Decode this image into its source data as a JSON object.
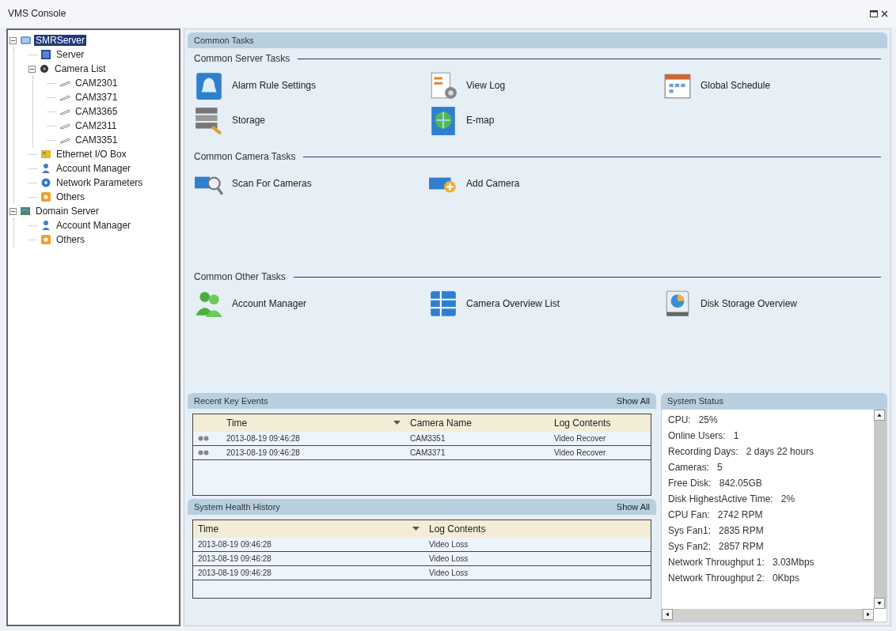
{
  "window": {
    "title": "VMS Console"
  },
  "tree": [
    {
      "label": "SMRServer",
      "kind": "server-group",
      "selected": true,
      "expanded": true,
      "children": [
        {
          "label": "Server",
          "kind": "monitor",
          "selected": false
        },
        {
          "label": "Camera List",
          "kind": "camera-group",
          "selected": false,
          "expanded": true,
          "children": [
            {
              "label": "CAM2301",
              "kind": "camera",
              "selected": false
            },
            {
              "label": "CAM3371",
              "kind": "camera",
              "selected": false
            },
            {
              "label": "CAM3365",
              "kind": "camera",
              "selected": false
            },
            {
              "label": "CAM2311",
              "kind": "camera",
              "selected": false
            },
            {
              "label": "CAM3351",
              "kind": "camera",
              "selected": false
            }
          ]
        },
        {
          "label": "Ethernet I/O Box",
          "kind": "io-box",
          "selected": false
        },
        {
          "label": "Account Manager",
          "kind": "user",
          "selected": false
        },
        {
          "label": "Network Parameters",
          "kind": "network",
          "selected": false
        },
        {
          "label": "Others",
          "kind": "others",
          "selected": false
        }
      ]
    },
    {
      "label": "Domain Server",
      "kind": "domain",
      "selected": false,
      "expanded": true,
      "children": [
        {
          "label": "Account Manager",
          "kind": "user",
          "selected": false
        },
        {
          "label": "Others",
          "kind": "others",
          "selected": false
        }
      ]
    }
  ],
  "common_tasks": {
    "title": "Common Tasks",
    "groups": [
      {
        "title": "Common Server Tasks",
        "items": [
          {
            "label": "Alarm Rule Settings",
            "kind": "alarm"
          },
          {
            "label": "View Log",
            "kind": "log"
          },
          {
            "label": "Global Schedule",
            "kind": "calendar"
          },
          {
            "label": "Storage",
            "kind": "storage"
          },
          {
            "label": "E-map",
            "kind": "globe"
          }
        ]
      },
      {
        "title": "Common Camera Tasks",
        "items": [
          {
            "label": "Scan For Cameras",
            "kind": "scan"
          },
          {
            "label": "Add Camera",
            "kind": "add-camera"
          }
        ]
      },
      {
        "title": "Common Other Tasks",
        "items": [
          {
            "label": "Account Manager",
            "kind": "users"
          },
          {
            "label": "Camera Overview List",
            "kind": "grid"
          },
          {
            "label": "Disk Storage Overview",
            "kind": "disk"
          }
        ]
      }
    ]
  },
  "recent_key_events": {
    "title": "Recent Key Events",
    "action": "Show All",
    "columns": [
      {
        "label": "Time",
        "sorted": true
      },
      {
        "label": "Camera Name",
        "sorted": false
      },
      {
        "label": "Log Contents",
        "sorted": false
      }
    ],
    "rows": [
      [
        "2013-08-19 09:46:28",
        "CAM3351",
        "Video Recover"
      ],
      [
        "2013-08-19 09:46:28",
        "CAM3371",
        "Video Recover"
      ]
    ]
  },
  "system_health_history": {
    "title": "System Health History",
    "action": "Show All",
    "columns": [
      {
        "label": "Time",
        "sorted": true
      },
      {
        "label": "Log Contents",
        "sorted": false
      }
    ],
    "rows": [
      [
        "2013-08-19 09:46:28",
        "Video Loss"
      ],
      [
        "2013-08-19 09:46:28",
        "Video Loss"
      ],
      [
        "2013-08-19 09:46:28",
        "Video Loss"
      ]
    ]
  },
  "system_status": {
    "title": "System Status",
    "items": [
      {
        "label": "CPU:",
        "value": "25%"
      },
      {
        "label": "Online Users:",
        "value": "1"
      },
      {
        "label": "Recording Days:",
        "value": "2 days 22 hours"
      },
      {
        "label": "Cameras:",
        "value": "5"
      },
      {
        "label": "Free Disk:",
        "value": "842.05GB"
      },
      {
        "label": "Disk HighestActive Time:",
        "value": "2%"
      },
      {
        "label": "CPU Fan:",
        "value": "2742 RPM"
      },
      {
        "label": "Sys Fan1:",
        "value": "2835 RPM"
      },
      {
        "label": "Sys Fan2:",
        "value": "2857 RPM"
      },
      {
        "label": "Network Throughput 1:",
        "value": "3.03Mbps"
      },
      {
        "label": "Network Throughput 2:",
        "value": "0Kbps"
      }
    ]
  }
}
